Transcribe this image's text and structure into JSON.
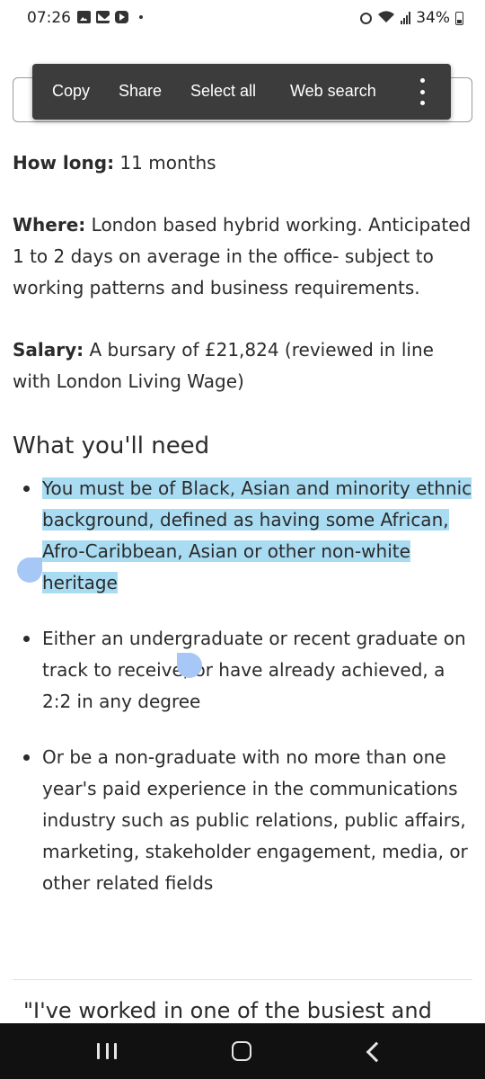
{
  "status_bar": {
    "time": "07:26",
    "battery": "34%"
  },
  "context_menu": {
    "items": [
      "Copy",
      "Share",
      "Select all",
      "Web search"
    ]
  },
  "job": {
    "how_long_label": "How long:",
    "how_long_value": " 11 months",
    "where_label": "Where:",
    "where_value": " London based hybrid working. Anticipated 1 to 2 days on average in the office- subject to working patterns and business requirements.",
    "salary_label": "Salary:",
    "salary_value": " A bursary of £21,824 (reviewed in line with London Living Wage)"
  },
  "needs": {
    "heading": "What you'll need",
    "items": [
      "You must be of Black, Asian and minority ethnic background, defined as having some African, Afro-Caribbean, Asian or other non-white heritage",
      "Either an undergraduate or recent graduate on track to receive, or have already achieved, a 2:2 in any degree",
      "Or be a non-graduate with no more than one year's paid experience in the communications industry such as public relations, public affairs, marketing, stakeholder engagement, media, or other related fields"
    ]
  },
  "quote_text": "\"I've worked in one of the busiest and",
  "colors": {
    "selection": "#a9dcf2",
    "handles": "#a7c7f6",
    "menu_bg": "#3c3c3c",
    "nav_bg": "#111111"
  },
  "icons": {
    "status": [
      "gallery-icon",
      "mail-icon",
      "youtube-icon",
      "alarm-icon",
      "wifi-icon",
      "signal-icon",
      "battery-icon"
    ],
    "nav": [
      "recents-icon",
      "home-icon",
      "back-icon"
    ]
  }
}
